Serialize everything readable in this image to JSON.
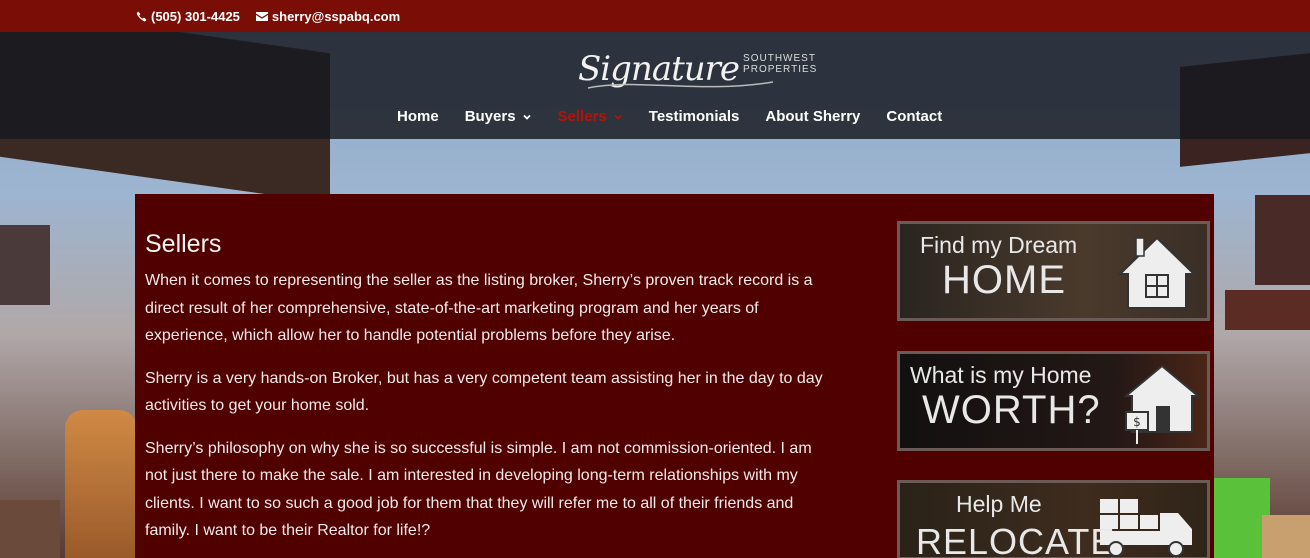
{
  "topbar": {
    "phone": "(505) 301-4425",
    "email": "sherry@sspabq.com",
    "phone_icon": "phone-icon",
    "email_icon": "envelope-icon"
  },
  "logo": {
    "script": "Signature",
    "line1": "SOUTHWEST",
    "line2": "PROPERTIES"
  },
  "nav": {
    "items": [
      {
        "label": "Home",
        "dropdown": false
      },
      {
        "label": "Buyers",
        "dropdown": true
      },
      {
        "label": "Sellers",
        "dropdown": true,
        "active": true
      },
      {
        "label": "Testimonials",
        "dropdown": false
      },
      {
        "label": "About Sherry",
        "dropdown": false
      },
      {
        "label": "Contact",
        "dropdown": false
      }
    ]
  },
  "main": {
    "title": "Sellers",
    "paragraphs": [
      "When it comes to representing the seller as the listing broker, Sherry’s proven track record is a direct result of her comprehensive, state-of-the-art marketing program and her years of experience, which allow her to handle potential problems before they arise.",
      "Sherry is a very hands-on Broker, but has a very competent team assisting her in the day to day activities to get your home sold.",
      "Sherry’s philosophy on why she is so successful is simple. I am not commission-oriented. I am not just there to make the sale. I am interested in developing long-term relationships with my clients. I want to so such a good job for them that they will refer me to all of their friends and family. I want to be their Realtor for life!?"
    ]
  },
  "sidebar": {
    "banners": [
      {
        "small": "Find my Dream",
        "big": "HOME",
        "icon": "house-icon"
      },
      {
        "small": "What is my Home",
        "big": "WORTH?",
        "icon": "house-for-sale-icon"
      },
      {
        "small": "Help Me",
        "big": "RELOCATE",
        "icon": "moving-truck-icon"
      }
    ]
  },
  "colors": {
    "topbar": "#7a0e06",
    "content_bg": "#510000",
    "active_nav": "#b0140a"
  }
}
